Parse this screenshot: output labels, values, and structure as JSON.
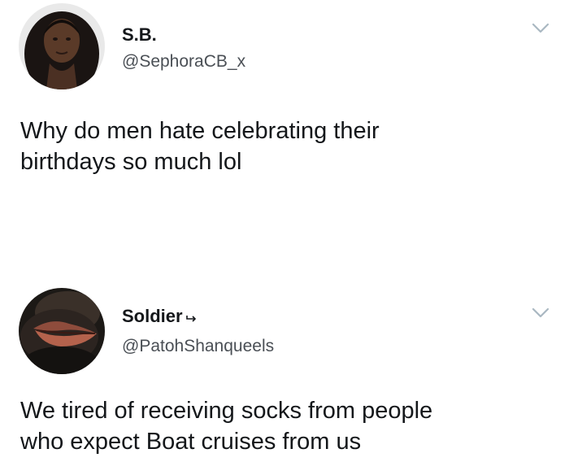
{
  "tweets": [
    {
      "display_name": "S.B.",
      "handle": "@SephoraCB_x",
      "text_lines": [
        "Why do men hate celebrating their",
        "birthdays so much lol"
      ],
      "avatar_icon": "profile-photo-woman",
      "menu_icon": "chevron-down-icon"
    },
    {
      "display_name": "Soldier",
      "handle": "@PatohShanqueels",
      "text_lines": [
        "We tired of receiving socks from people",
        "who expect Boat cruises from us"
      ],
      "name_suffix_icon": "arrow-icon",
      "avatar_icon": "profile-photo-lips",
      "menu_icon": "chevron-down-icon"
    }
  ],
  "colors": {
    "text": "#14171a",
    "handle": "#4a4f55",
    "chevron": "#aab8c2",
    "background": "#ffffff"
  }
}
